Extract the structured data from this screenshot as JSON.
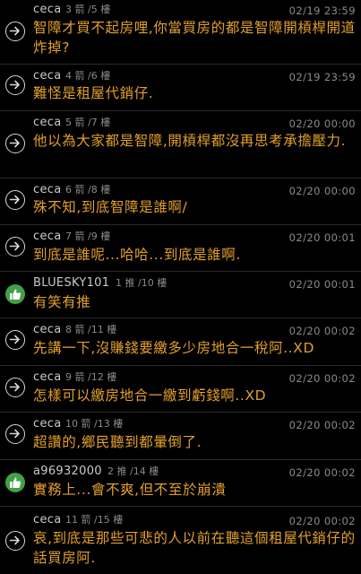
{
  "comments": [
    {
      "user": "ceca",
      "floor": "3 箭 /5 樓",
      "time": "02/19 23:59",
      "icon": "arrow-right-circle-icon",
      "text": "智障才買不起房哩,你當買房的都是智障開槓桿開道炸掉?"
    },
    {
      "user": "ceca",
      "floor": "4 箭 /6 樓",
      "time": "02/19 23:59",
      "icon": "arrow-right-circle-icon",
      "text": "難怪是租屋代銷仔."
    },
    {
      "user": "ceca",
      "floor": "5 箭 /7 樓",
      "time": "02/20 00:00",
      "icon": "arrow-right-circle-icon",
      "text": "他以為大家都是智障,開槓桿都沒再思考承擔壓力."
    },
    {
      "user": "ceca",
      "floor": "6 箭 /8 樓",
      "time": "02/20 00:00",
      "icon": "arrow-right-circle-icon",
      "text": "殊不知,到底智障是誰啊/"
    },
    {
      "user": "ceca",
      "floor": "7 箭 /9 樓",
      "time": "02/20 00:01",
      "icon": "arrow-right-circle-icon",
      "text": "到底是誰呢...哈哈...到底是誰啊."
    },
    {
      "user": "BLUESKY101",
      "floor": "1 推 /10 樓",
      "time": "02/20 00:01",
      "icon": "thumbs-up-icon",
      "text": "有笑有推"
    },
    {
      "user": "ceca",
      "floor": "8 箭 /11 樓",
      "time": "02/20 00:02",
      "icon": "arrow-right-circle-icon",
      "text": "先講一下,沒賺錢要繳多少房地合一稅阿..XD"
    },
    {
      "user": "ceca",
      "floor": "9 箭 /12 樓",
      "time": "02/20 00:02",
      "icon": "arrow-right-circle-icon",
      "text": "怎樣可以繳房地合一繳到虧錢啊..XD"
    },
    {
      "user": "ceca",
      "floor": "10 箭 /13 樓",
      "time": "02/20 00:02",
      "icon": "arrow-right-circle-icon",
      "text": "超讚的,鄉民聽到都暈倒了."
    },
    {
      "user": "a96932000",
      "floor": "2 推 /14 樓",
      "time": "02/20 00:02",
      "icon": "thumbs-up-icon",
      "text": "實務上...會不爽,但不至於崩潰"
    },
    {
      "user": "ceca",
      "floor": "11 箭 /15 樓",
      "time": "02/20 00:02",
      "icon": "arrow-right-circle-icon",
      "text": "哀,到底是那些可悲的人以前在聽這個租屋代銷仔的話買房阿."
    }
  ]
}
